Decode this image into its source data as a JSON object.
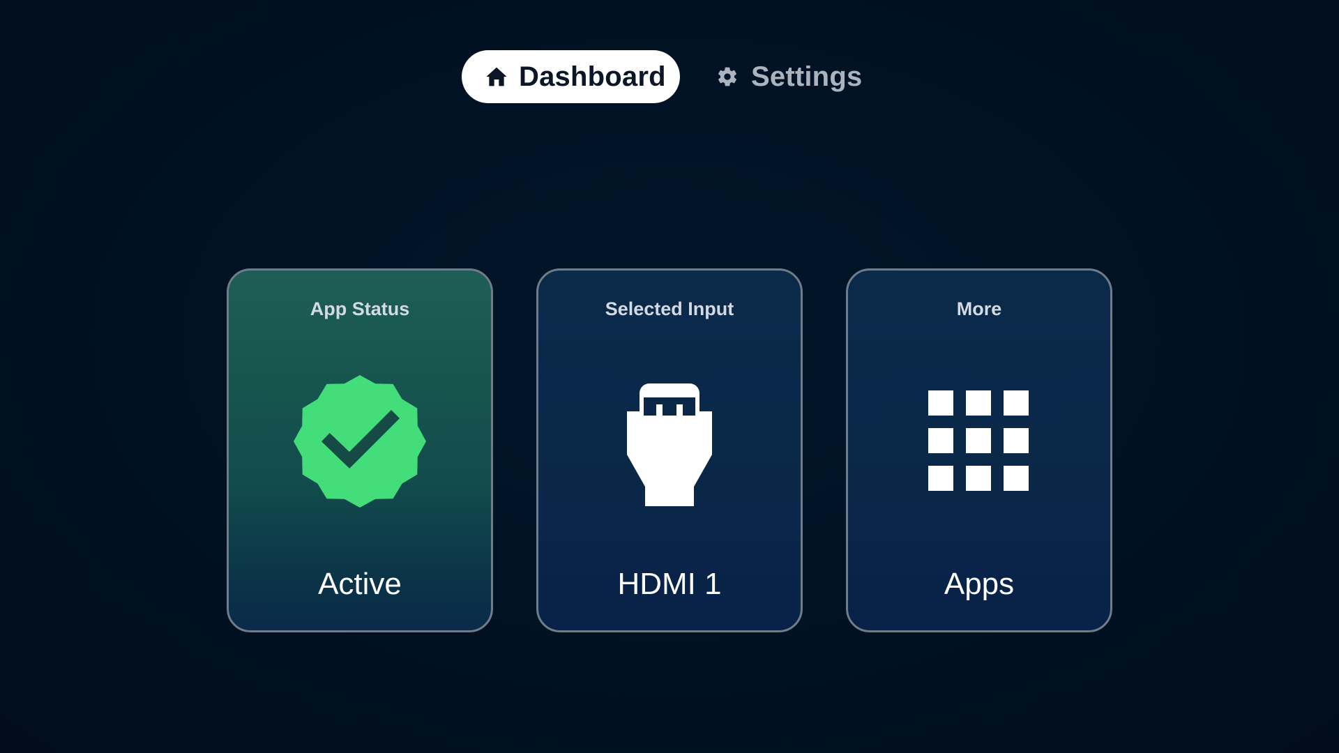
{
  "nav": {
    "tabs": [
      {
        "label": "Dashboard",
        "icon": "home-icon",
        "active": true
      },
      {
        "label": "Settings",
        "icon": "gear-icon",
        "active": false
      }
    ]
  },
  "cards": [
    {
      "title": "App Status",
      "value": "Active",
      "icon": "verified-badge-icon",
      "focused": true
    },
    {
      "title": "Selected Input",
      "value": "HDMI 1",
      "icon": "hdmi-connector-icon",
      "focused": false
    },
    {
      "title": "More",
      "value": "Apps",
      "icon": "apps-grid-icon",
      "focused": false
    }
  ],
  "colors": {
    "background": "#011224",
    "focused_card": "#17574f",
    "card": "#0a2748",
    "accent_green": "#43de7a",
    "inactive_tab_text": "#aab3be"
  }
}
